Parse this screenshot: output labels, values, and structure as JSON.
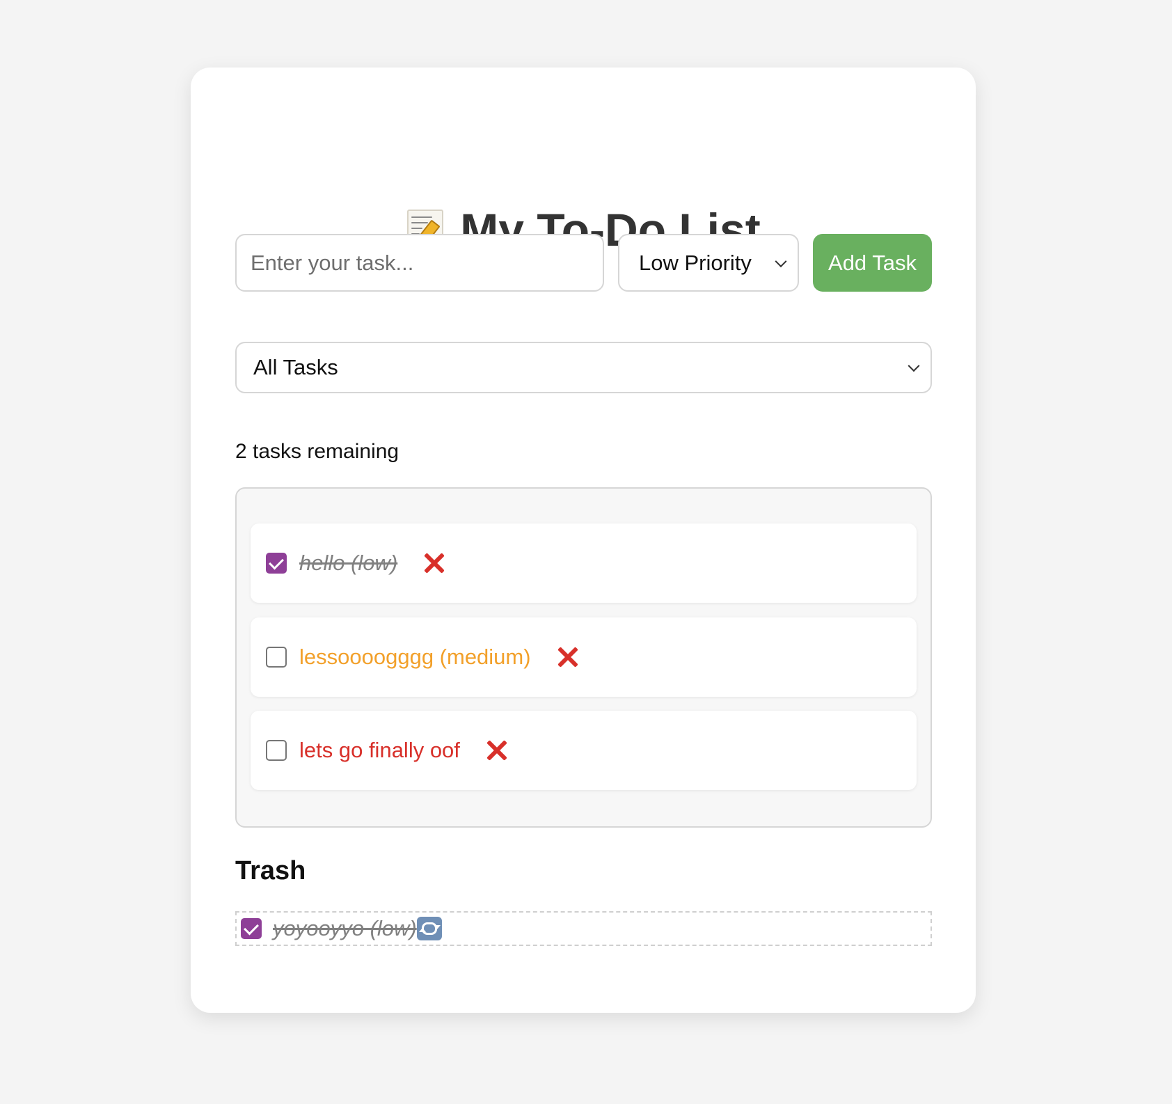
{
  "header": {
    "title": "My To-Do List",
    "title_icon": "memo-icon"
  },
  "new_task": {
    "placeholder": "Enter your task...",
    "value": "",
    "priority_selected": "Low Priority",
    "add_label": "Add Task"
  },
  "filter": {
    "selected": "All Tasks"
  },
  "status": {
    "remaining_text": "2 tasks remaining"
  },
  "tasks": [
    {
      "label": "hello (low)",
      "completed": true,
      "color": "#808080",
      "delete_icon": "cross-mark-icon"
    },
    {
      "label": "lessoooogggg (medium)",
      "completed": false,
      "color": "#f2a02a",
      "delete_icon": "cross-mark-icon"
    },
    {
      "label": "lets go finally oof",
      "completed": false,
      "color": "#d8302a",
      "delete_icon": "cross-mark-icon"
    }
  ],
  "trash": {
    "heading": "Trash",
    "items": [
      {
        "label": "yoyooyyo (low)",
        "completed": true,
        "restore_icon": "restore-icon"
      }
    ]
  },
  "colors": {
    "accent_purple": "#8e3f97",
    "add_button_green": "#69b05f",
    "delete_red": "#d8302a",
    "medium_orange": "#f2a02a"
  }
}
